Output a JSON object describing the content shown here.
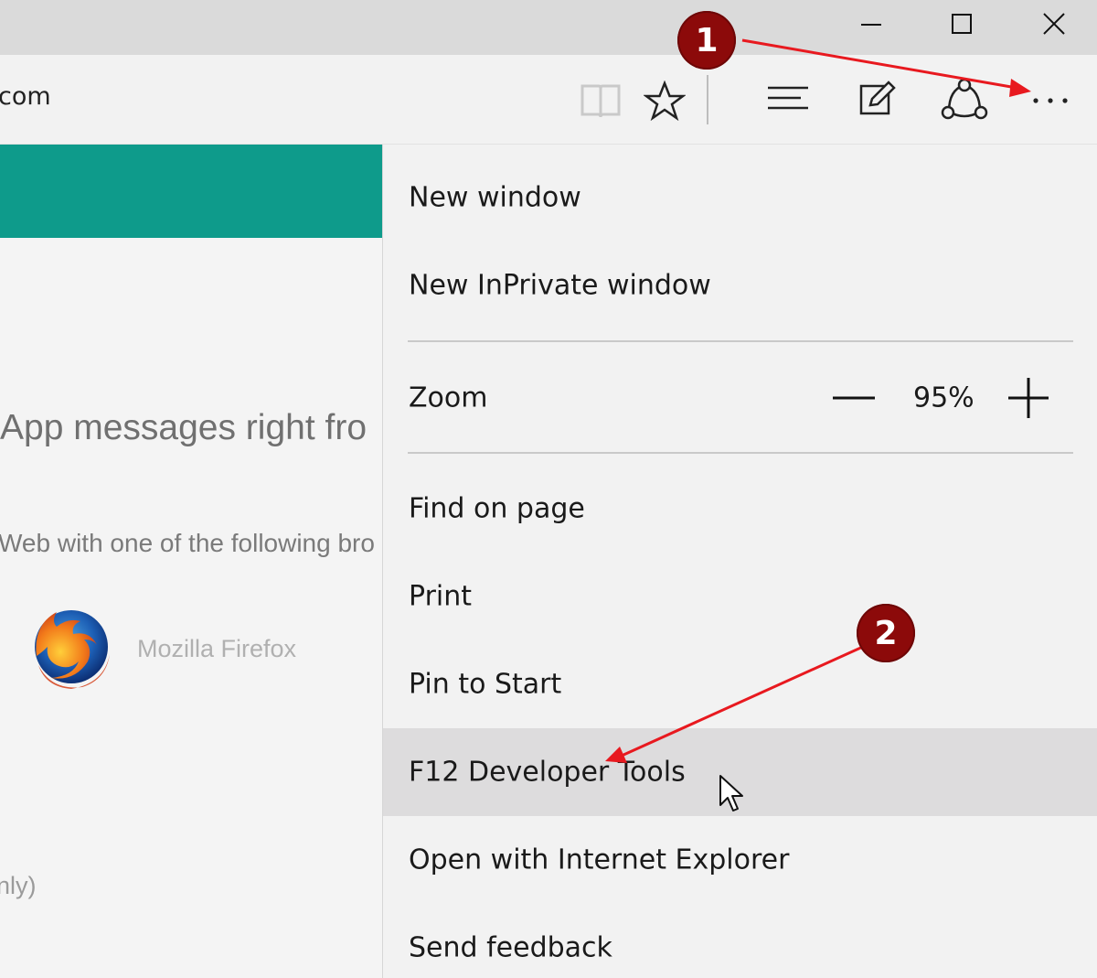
{
  "window": {
    "controls": [
      "minimize-icon",
      "maximize-icon",
      "close-icon"
    ]
  },
  "toolbar": {
    "url_fragment": "com",
    "icons": [
      "reading-view-icon",
      "favorites-star-icon",
      "hub-icon",
      "web-note-icon",
      "share-icon",
      "more-actions-icon"
    ]
  },
  "page": {
    "headline": "App messages right fro",
    "subline": "Web with one of the following bro",
    "browser_label": "Mozilla Firefox",
    "footnote": "nly)",
    "accent_color": "#0e9b8b"
  },
  "menu": {
    "new_window": "New window",
    "new_inprivate": "New InPrivate window",
    "zoom_label": "Zoom",
    "zoom_value": "95%",
    "find_on_page": "Find on page",
    "print": "Print",
    "pin_to_start": "Pin to Start",
    "dev_tools": "F12 Developer Tools",
    "open_ie": "Open with Internet Explorer",
    "send_feedback": "Send feedback",
    "hover_color": "#dddcdd"
  },
  "annotations": {
    "step1": "1",
    "step2": "2",
    "color": "#8c0a0a",
    "arrow_color": "#e8191f"
  }
}
